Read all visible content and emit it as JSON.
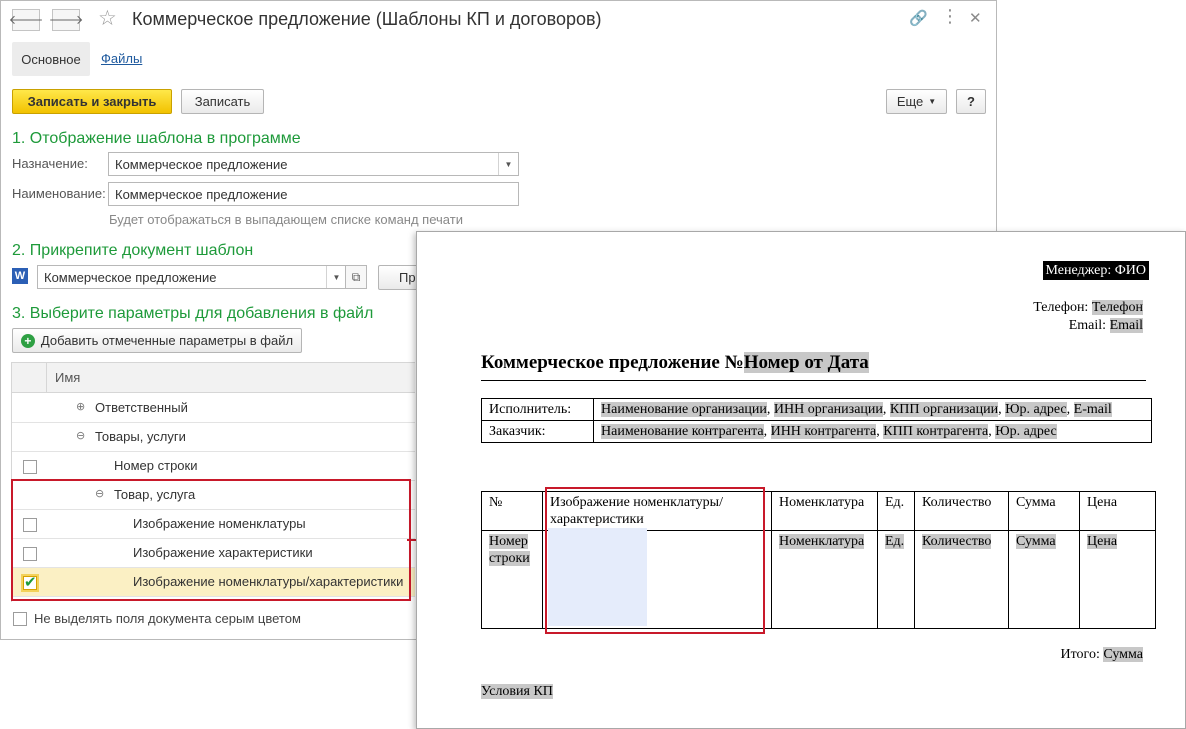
{
  "window": {
    "title": "Коммерческое предложение (Шаблоны КП и договоров)",
    "back_icon": "arrow-left-icon",
    "forward_icon": "arrow-right-icon"
  },
  "tabs": {
    "main": "Основное",
    "files": "Файлы"
  },
  "toolbar": {
    "save_close": "Записать и закрыть",
    "save": "Записать",
    "more": "Еще",
    "help": "?"
  },
  "section1": {
    "title": "1. Отображение шаблона в программе",
    "purpose_label": "Назначение:",
    "purpose_value": "Коммерческое предложение",
    "name_label": "Наименование:",
    "name_value": "Коммерческое предложение",
    "hint": "Будет отображаться в выпадающем списке команд печати"
  },
  "section2": {
    "title": "2. Прикрепите документ шаблон",
    "doc_value": "Коммерческое предложение",
    "cut_button": "Пр"
  },
  "section3": {
    "title": "3. Выберите параметры для добавления в файл",
    "add_button": "Добавить отмеченные параметры в файл",
    "column_header": "Имя",
    "rows": [
      {
        "label": "Ответственный",
        "expander": "⊕"
      },
      {
        "label": "Товары, услуги",
        "expander": "⊖"
      },
      {
        "label": "Номер строки"
      },
      {
        "label": "Товар, услуга",
        "expander": "⊖"
      },
      {
        "label": "Изображение номенклатуры"
      },
      {
        "label": "Изображение характеристики"
      },
      {
        "label": "Изображение номенклатуры/характеристики"
      }
    ],
    "gray_option": "Не выделять поля документа серым цветом"
  },
  "doc": {
    "manager_label": "Менеджер:",
    "manager_value": "ФИО",
    "phone_label": "Телефон:",
    "phone_value": "Телефон",
    "email_label": "Email:",
    "email_value": "Email",
    "title_prefix": "Коммерческое предложение №",
    "title_number": "Номер",
    "title_from": " от ",
    "title_date": "Дата",
    "parties": {
      "executor_label": "Исполнитель:",
      "executor_parts": [
        "Наименование организации",
        "ИНН организации",
        "КПП организации",
        "Юр. адрес",
        "E-mail"
      ],
      "customer_label": "Заказчик:",
      "customer_parts": [
        "Наименование контрагента",
        "ИНН контрагента",
        "КПП контрагента",
        "Юр. адрес"
      ]
    },
    "items": {
      "headers": [
        "№",
        "Изображение номенклатуры/характеристики",
        "Номенклатура",
        "Ед.",
        "Количество",
        "Сумма",
        "Цена"
      ],
      "row": [
        "Номер строки",
        "",
        "Номенклатура",
        "Ед.",
        "Количество",
        "Сумма",
        "Цена"
      ]
    },
    "total_label": "Итого:",
    "total_value": "Сумма",
    "conditions": "Условия КП"
  }
}
